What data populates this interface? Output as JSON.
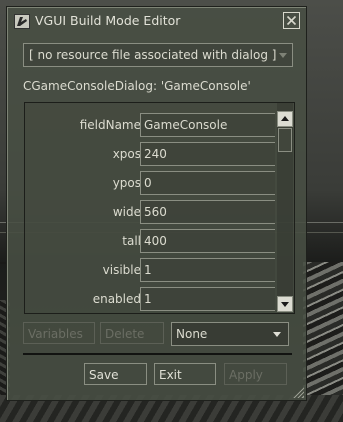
{
  "window": {
    "title": "VGUI Build Mode Editor"
  },
  "resource_dropdown": {
    "selected": "[ no resource file associated with dialog ]"
  },
  "dialog_label": "CGameConsoleDialog: 'GameConsole'",
  "fields": [
    {
      "name": "fieldName",
      "value": "GameConsole"
    },
    {
      "name": "xpos",
      "value": "240"
    },
    {
      "name": "ypos",
      "value": "0"
    },
    {
      "name": "wide",
      "value": "560"
    },
    {
      "name": "tall",
      "value": "400"
    },
    {
      "name": "visible",
      "value": "1"
    },
    {
      "name": "enabled",
      "value": "1"
    }
  ],
  "toolbar": {
    "variables_label": "Variables",
    "delete_label": "Delete",
    "type_dropdown_selected": "None"
  },
  "footer": {
    "save_label": "Save",
    "exit_label": "Exit",
    "apply_label": "Apply"
  },
  "icons": {
    "app": "app-logo-icon",
    "close": "close-icon",
    "scroll_up": "arrow-up-icon",
    "scroll_down": "arrow-down-icon",
    "dropdown": "chevron-down-icon",
    "resize": "resize-grip-icon"
  },
  "colors": {
    "panel": "#484e43",
    "text": "#dcdcd0",
    "disabled_text": "#6b6e64",
    "border": "#8a8e82"
  }
}
